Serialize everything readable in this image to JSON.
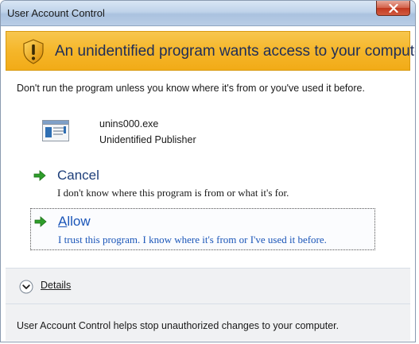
{
  "window": {
    "title": "User Account Control"
  },
  "banner": {
    "heading": "An unidentified program wants access to your computer",
    "icon": "uac-shield-warning-icon"
  },
  "intro_text": "Don't run the program unless you know where it's from or you've used it before.",
  "program": {
    "name": "unins000.exe",
    "publisher": "Unidentified Publisher",
    "icon": "program-icon"
  },
  "options": {
    "cancel": {
      "label": "Cancel",
      "description": "I don't know where this program is from or what it's for."
    },
    "allow": {
      "label_accel": "A",
      "label_rest": "llow",
      "description": "I trust this program. I know where it's from or I've used it before."
    }
  },
  "details": {
    "label_accel": "D",
    "label_rest": "etails"
  },
  "footer": {
    "text": "User Account Control helps stop unauthorized changes to your computer."
  },
  "colors": {
    "banner": "#f5b62a",
    "link_blue": "#1a55b8",
    "arrow_green": "#2e9e2a",
    "close_red": "#c1381f"
  }
}
